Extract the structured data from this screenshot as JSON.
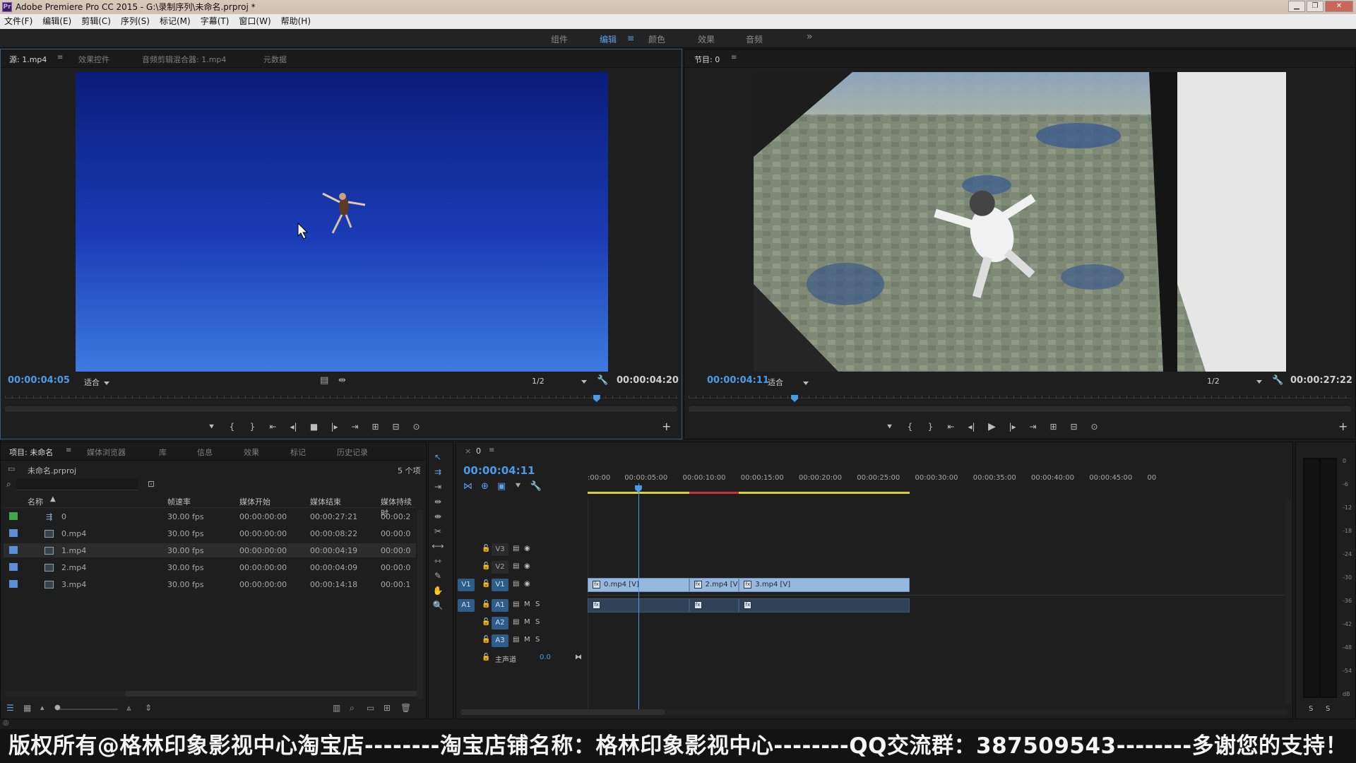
{
  "window": {
    "title": "Adobe Premiere Pro CC 2015 - G:\\录制序列\\未命名.prproj *",
    "app_icon_label": "Pr",
    "controls": [
      "▁",
      "❐",
      "✕"
    ]
  },
  "menu": [
    "文件(F)",
    "编辑(E)",
    "剪辑(C)",
    "序列(S)",
    "标记(M)",
    "字幕(T)",
    "窗口(W)",
    "帮助(H)"
  ],
  "workspaces": {
    "items": [
      "组件",
      "编辑",
      "颜色",
      "效果",
      "音频"
    ],
    "active": "编辑",
    "menu_glyph": "≡",
    "overflow": "»"
  },
  "source_monitor": {
    "tabs": [
      "源: 1.mp4",
      "效果控件",
      "音频剪辑混合器: 1.mp4",
      "元数据"
    ],
    "menu_glyph": "≡",
    "timecode_current": "00:00:04:05",
    "zoom": "适合",
    "resolution": "1/2",
    "timecode_duration": "00:00:04:20",
    "playhead_fraction": 0.88
  },
  "program_monitor": {
    "tab": "节目: 0",
    "menu_glyph": "≡",
    "timecode_current": "00:00:04:11",
    "zoom": "适合",
    "resolution": "1/2",
    "timecode_duration": "00:00:27:22",
    "playhead_fraction": 0.16
  },
  "transport_icons": [
    "marker-icon",
    "in-point-icon",
    "out-point-icon",
    "go-to-in-icon",
    "step-back-icon",
    "stop-icon",
    "step-forward-icon",
    "go-to-out-icon",
    "insert-icon",
    "overwrite-icon",
    "export-frame-icon"
  ],
  "project_panel": {
    "tabs": [
      "项目: 未命名",
      "媒体浏览器",
      "库",
      "信息",
      "效果",
      "标记",
      "历史记录"
    ],
    "project_file": "未命名.prproj",
    "item_count": "5 个项",
    "columns": [
      "名称",
      "帧速率",
      "媒体开始",
      "媒体结束",
      "媒体持续时"
    ],
    "rows": [
      {
        "color": "#3fa84a",
        "icon": "sequence-icon",
        "name": "0",
        "fps": "30.00 fps",
        "start": "00:00:00:00",
        "end": "00:00:27:21",
        "dur": "00:00:2"
      },
      {
        "color": "#5b8fd6",
        "icon": "clip-icon",
        "name": "0.mp4",
        "fps": "30.00 fps",
        "start": "00:00:00:00",
        "end": "00:00:08:22",
        "dur": "00:00:0"
      },
      {
        "color": "#5b8fd6",
        "icon": "clip-icon",
        "name": "1.mp4",
        "fps": "30.00 fps",
        "start": "00:00:00:00",
        "end": "00:00:04:19",
        "dur": "00:00:0"
      },
      {
        "color": "#5b8fd6",
        "icon": "clip-icon",
        "name": "2.mp4",
        "fps": "30.00 fps",
        "start": "00:00:00:00",
        "end": "00:00:04:09",
        "dur": "00:00:0"
      },
      {
        "color": "#5b8fd6",
        "icon": "clip-icon",
        "name": "3.mp4",
        "fps": "30.00 fps",
        "start": "00:00:00:00",
        "end": "00:00:14:18",
        "dur": "00:00:1"
      }
    ],
    "selected_row": 2
  },
  "timeline": {
    "tab_close": "×",
    "tab_label": "0",
    "menu_glyph": "≡",
    "timecode": "00:00:04:11",
    "ruler_labels": [
      ":00:00",
      "00:00:05:00",
      "00:00:10:00",
      "00:00:15:00",
      "00:00:20:00",
      "00:00:25:00",
      "00:00:30:00",
      "00:00:35:00",
      "00:00:40:00",
      "00:00:45:00",
      "00"
    ],
    "video_tracks": [
      {
        "src": "",
        "name": "V3"
      },
      {
        "src": "",
        "name": "V2"
      },
      {
        "src": "V1",
        "name": "V1"
      }
    ],
    "audio_tracks": [
      {
        "src": "A1",
        "name": "A1",
        "m": "M",
        "s": "S"
      },
      {
        "src": "",
        "name": "A2",
        "m": "M",
        "s": "S"
      },
      {
        "src": "",
        "name": "A3",
        "m": "M",
        "s": "S"
      }
    ],
    "master": {
      "label": "主声道",
      "value": "0.0"
    },
    "clips": [
      {
        "label": "0.mp4 [V]",
        "start": 0.0,
        "end": 8.73
      },
      {
        "label": "2.mp4 [V]",
        "start": 8.73,
        "end": 13.03
      },
      {
        "label": "3.mp4 [V]",
        "start": 13.03,
        "end": 27.73
      }
    ],
    "playhead_seconds": 4.37
  },
  "audio_meter": {
    "db_labels": [
      "0",
      "-6",
      "-12",
      "-18",
      "-24",
      "-30",
      "-36",
      "-42",
      "-48",
      "-54",
      "dB"
    ],
    "solo_labels": [
      "S",
      "S"
    ]
  },
  "watermark": "版权所有@格林印象影视中心淘宝店--------淘宝店铺名称：格林印象影视中心--------QQ交流群：387509543--------多谢您的支持！"
}
